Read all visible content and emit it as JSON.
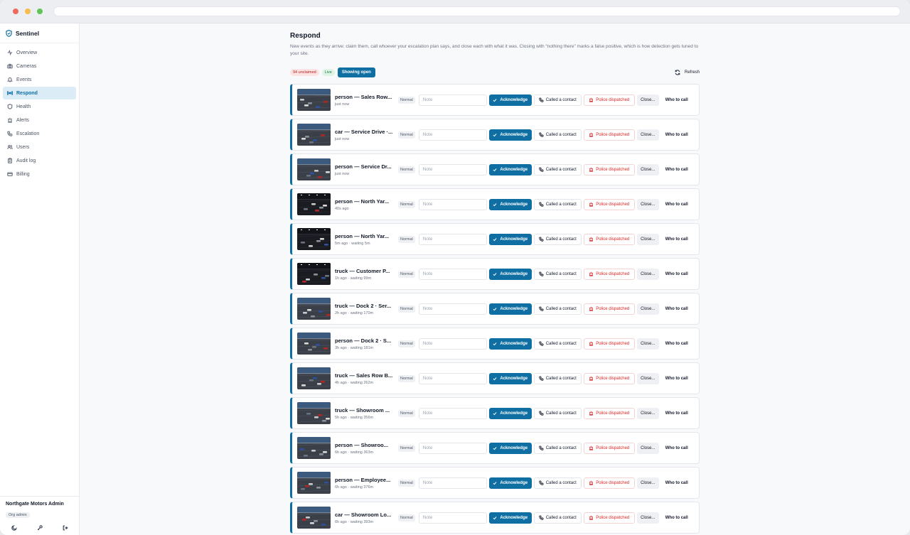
{
  "app": {
    "name": "Sentinel"
  },
  "nav": [
    {
      "label": "Overview",
      "icon": "activity-icon",
      "active": false
    },
    {
      "label": "Cameras",
      "icon": "camera-icon",
      "active": false
    },
    {
      "label": "Events",
      "icon": "bell-icon",
      "active": false
    },
    {
      "label": "Respond",
      "icon": "radio-icon",
      "active": true
    },
    {
      "label": "Health",
      "icon": "shield-icon",
      "active": false
    },
    {
      "label": "Alerts",
      "icon": "siren-icon",
      "active": false
    },
    {
      "label": "Escalation",
      "icon": "phone-icon",
      "active": false
    },
    {
      "label": "Users",
      "icon": "users-icon",
      "active": false
    },
    {
      "label": "Audit log",
      "icon": "clipboard-icon",
      "active": false
    },
    {
      "label": "Billing",
      "icon": "card-icon",
      "active": false
    }
  ],
  "footer": {
    "org_name": "Northgate Motors Admin",
    "role": "Org admin"
  },
  "page": {
    "title": "Respond",
    "description": "New events as they arrive: claim them, call whoever your escalation plan says, and close each with what it was. Closing with “nothing there” marks a false positive, which is how detection gets tuned to your site.",
    "unclaimed_badge": "94 unclaimed",
    "live_badge": "Live",
    "filter_button": "Showing open",
    "refresh_button": "Refresh"
  },
  "labels": {
    "priority": "Normal",
    "note_placeholder": "Note",
    "acknowledge": "Acknowledge",
    "called": "Called a contact",
    "police": "Police dispatched",
    "close": "Close...",
    "who": "Who to call"
  },
  "colors": {
    "accent": "#0f6fa3",
    "danger": "#dc2626",
    "live": "#15803d"
  },
  "events": [
    {
      "title": "person — Sales Row...",
      "time": "just now",
      "scene": "day"
    },
    {
      "title": "car — Service Drive ·...",
      "time": "just now",
      "scene": "day"
    },
    {
      "title": "person — Service Dr...",
      "time": "just now",
      "scene": "day"
    },
    {
      "title": "person — North Yar...",
      "time": "40s ago",
      "scene": "night"
    },
    {
      "title": "person — North Yar...",
      "time": "5m ago · waiting 5m",
      "scene": "night"
    },
    {
      "title": "truck — Customer P...",
      "time": "1h ago · waiting 99m",
      "scene": "night"
    },
    {
      "title": "truck — Dock 2 · Ser...",
      "time": "2h ago · waiting 170m",
      "scene": "day"
    },
    {
      "title": "person — Dock 2 · S...",
      "time": "3h ago · waiting 181m",
      "scene": "day"
    },
    {
      "title": "truck — Sales Row B...",
      "time": "4h ago · waiting 262m",
      "scene": "day"
    },
    {
      "title": "truck — Showroom ...",
      "time": "5h ago · waiting 356m",
      "scene": "day"
    },
    {
      "title": "person — Showroo...",
      "time": "6h ago · waiting 363m",
      "scene": "day"
    },
    {
      "title": "person — Employee...",
      "time": "6h ago · waiting 376m",
      "scene": "day"
    },
    {
      "title": "car — Showroom Lo...",
      "time": "6h ago · waiting 393m",
      "scene": "day"
    }
  ]
}
